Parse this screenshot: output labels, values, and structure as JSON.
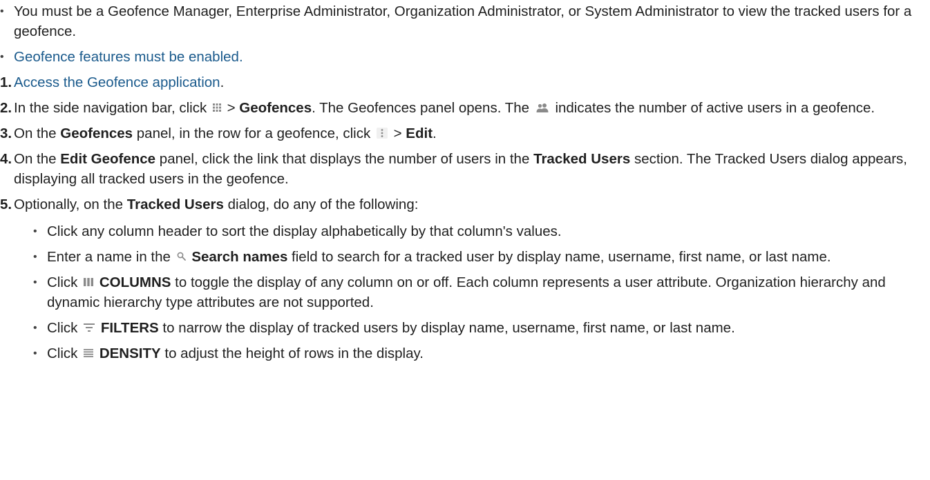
{
  "prereqs": [
    "You must be a Geofence Manager, Enterprise Administrator, Organization Administrator, or System Administrator to view the tracked users for a geofence.",
    "Geofence features must be enabled."
  ],
  "steps": {
    "s1": {
      "num": "1.",
      "link": "Access the Geofence application",
      "end": "."
    },
    "s2": {
      "num": "2.",
      "t1": "In the side navigation bar, click",
      "t2": " > ",
      "b1": "Geofences",
      "t3": ". The Geofences panel opens. The",
      "t4": "indicates the number of active users in a geofence."
    },
    "s3": {
      "num": "3.",
      "t1": "On the ",
      "b1": "Geofences",
      "t2": " panel, in the row for a geofence, click",
      "t3": " > ",
      "b2": "Edit",
      "t4": "."
    },
    "s4": {
      "num": "4.",
      "t1": "On the ",
      "b1": "Edit Geofence",
      "t2": " panel, click the link that displays the number of users in the ",
      "b2": "Tracked Users",
      "t3": " section. The Tracked Users dialog appears, displaying all tracked users in the geofence."
    },
    "s5": {
      "num": "5.",
      "t1": "Optionally, on the ",
      "b1": "Tracked Users",
      "t2": " dialog, do any of the following:"
    }
  },
  "sub": {
    "i1": {
      "text": "Click any column header to sort the display alphabetically by that column's values."
    },
    "i2": {
      "t1": "Enter a name in the",
      "b1": "Search names",
      "t2": " field to search for a tracked user by display name, username, first name, or last name."
    },
    "i3": {
      "t1": "Click",
      "b1": "COLUMNS",
      "t2": " to toggle the display of any column on or off. Each column represents a user attribute. Organization hierarchy and dynamic hierarchy type attributes are not supported."
    },
    "i4": {
      "t1": "Click",
      "b1": "FILTERS",
      "t2": " to narrow the display of tracked users by display name, username, first name, or last name."
    },
    "i5": {
      "t1": "Click",
      "b1": "DENSITY",
      "t2": " to adjust the height of rows in the display."
    }
  },
  "icons": {
    "grid": "grid-icon",
    "users": "users-icon",
    "kebab": "more-vertical-icon",
    "search": "search-icon",
    "columns": "columns-icon",
    "filter": "filter-icon",
    "density": "density-icon"
  },
  "colors": {
    "link": "#1a5a8c",
    "text": "#1f1f1f",
    "icon": "#8a8a8a"
  }
}
